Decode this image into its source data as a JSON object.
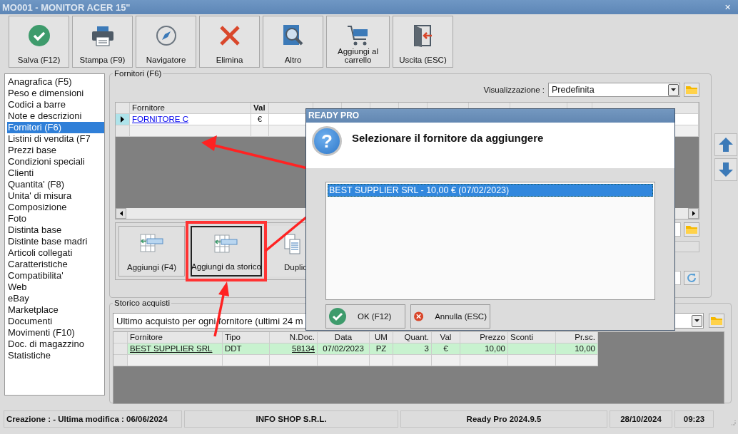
{
  "window": {
    "title": "MO001 - MONITOR ACER 15\"",
    "close": "✕"
  },
  "toolbar": [
    {
      "label": "Salva (F12)",
      "kind": "save"
    },
    {
      "label": "Stampa (F9)",
      "kind": "print"
    },
    {
      "label": "Navigatore",
      "kind": "compass"
    },
    {
      "label": "Elimina",
      "kind": "delete"
    },
    {
      "label": "Altro",
      "kind": "search"
    },
    {
      "label": "Aggiungi al carrello",
      "kind": "cart"
    },
    {
      "label": "Uscita (ESC)",
      "kind": "exit"
    }
  ],
  "sidebar": {
    "items": [
      {
        "label": "Anagrafica (F5)",
        "selected": false
      },
      {
        "label": "Peso e dimensioni",
        "selected": false
      },
      {
        "label": "Codici a barre",
        "selected": false
      },
      {
        "label": "Note e descrizioni",
        "selected": false
      },
      {
        "label": "Fornitori (F6)",
        "selected": true
      },
      {
        "label": "Listini di vendita (F7",
        "selected": false
      },
      {
        "label": "Prezzi base",
        "selected": false
      },
      {
        "label": "Condizioni speciali",
        "selected": false
      },
      {
        "label": "Clienti",
        "selected": false
      },
      {
        "label": "Quantita' (F8)",
        "selected": false
      },
      {
        "label": "Unita' di misura",
        "selected": false
      },
      {
        "label": "Composizione",
        "selected": false
      },
      {
        "label": "Foto",
        "selected": false
      },
      {
        "label": "Distinta base",
        "selected": false
      },
      {
        "label": "Distinte base madri",
        "selected": false
      },
      {
        "label": "Articoli collegati",
        "selected": false
      },
      {
        "label": "Caratteristiche",
        "selected": false
      },
      {
        "label": "Compatibilita'",
        "selected": false
      },
      {
        "label": "Web",
        "selected": false
      },
      {
        "label": "eBay",
        "selected": false
      },
      {
        "label": "Marketplace",
        "selected": false
      },
      {
        "label": "Documenti",
        "selected": false
      },
      {
        "label": "Movimenti (F10)",
        "selected": false
      },
      {
        "label": "Doc. di magazzino",
        "selected": false
      },
      {
        "label": "Statistiche",
        "selected": false
      }
    ]
  },
  "suppliers_panel": {
    "title": "Fornitori (F6)",
    "view_label": "Visualizzazione :",
    "view_value": "Predefinita",
    "table": {
      "columns": [
        "Fornitore",
        "Val"
      ],
      "rows": [
        {
          "supplier": "FORNITORE C",
          "currency": "€",
          "current": true
        }
      ]
    },
    "actions": [
      {
        "label": "Aggiungi (F4)",
        "kind": "add",
        "highlighted": false
      },
      {
        "label": "Aggiungi da storico",
        "kind": "add",
        "highlighted": true
      },
      {
        "label": "Duplic",
        "kind": "duplicate",
        "highlighted": false
      }
    ]
  },
  "history": {
    "title": "Storico acquisti",
    "filter": "Ultimo acquisto per ogni fornitore (ultimi 24 m",
    "columns": [
      "Fornitore",
      "Tipo",
      "N.Doc.",
      "Data",
      "UM",
      "Quant.",
      "Val",
      "Prezzo",
      "Sconti",
      "Pr.sc."
    ],
    "rows": [
      {
        "cells": [
          "BEST SUPPLIER SRL",
          "DDT",
          "58134",
          "07/02/2023",
          "PZ",
          "3",
          "€",
          "10,00",
          "",
          "10,00"
        ]
      }
    ]
  },
  "status_bar": [
    "Creazione :  - Ultima modifica : 06/06/2024",
    "INFO SHOP S.R.L.",
    "Ready Pro 2024.9.5",
    "28/10/2024",
    "09:23"
  ],
  "dialog": {
    "title": "READY PRO",
    "icon": "?",
    "message": "Selezionare il fornitore da aggiungere",
    "options": [
      {
        "label": "BEST SUPPLIER SRL -  10,00 € (07/02/2023)",
        "selected": true
      }
    ],
    "buttons": [
      {
        "label": "OK (F12)",
        "kind": "ok"
      },
      {
        "label": "Annulla (ESC)",
        "kind": "cancel"
      }
    ]
  }
}
